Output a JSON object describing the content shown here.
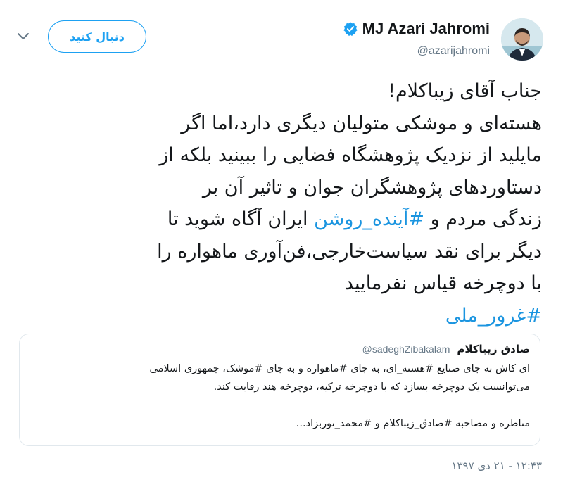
{
  "header": {
    "display_name": "MJ Azari Jahromi",
    "handle": "@azarijahromi",
    "follow_label": "دنبال کنید",
    "icons": {
      "verified": "verified-badge-icon",
      "menu": "chevron-down-icon",
      "avatar": "profile-photo"
    },
    "colors": {
      "accent": "#1da1f2",
      "hashtag": "#1b95e0",
      "muted": "#657786"
    }
  },
  "tweet": {
    "line1": "جناب آقای زیباکلام!",
    "line2": "هسته‌ای و موشکی متولیان دیگری دارد،اما اگر",
    "line3": "مایلید از نزدیک پژوهشگاه فضایی را ببینید بلکه از",
    "line4": "دستاوردهای پژوهشگران جوان و تاثیر آن بر",
    "line5_a": "زندگی مردم و ",
    "line5_tag": "#آینده_روشن",
    "line5_b": " ایران آگاه شوید تا",
    "line6": "دیگر برای نقد سیاست‌خارجی،فن‌آوری ماهواره را",
    "line7": "با دوچرخه قیاس نفرمایید",
    "hashtag_last": "#غرور_ملی"
  },
  "quoted": {
    "name": "صادق زیباکلام",
    "handle": "@sadeghZibakalam",
    "line1": "ای کاش به جای صنایع #هسته_ای، به جای #ماهواره و به جای #موشک، جمهوری اسلامی",
    "line2": "می‌توانست یک دوچرخه بسازد که با دوچرخه ترکیه، دوچرخه هند رقابت کند.",
    "line3": "مناظره و مصاحبه #صادق_زیباکلام و #محمد_نوربزاد..."
  },
  "timestamp": "۱۲:۴۳ - ۲۱ دی ۱۳۹۷"
}
